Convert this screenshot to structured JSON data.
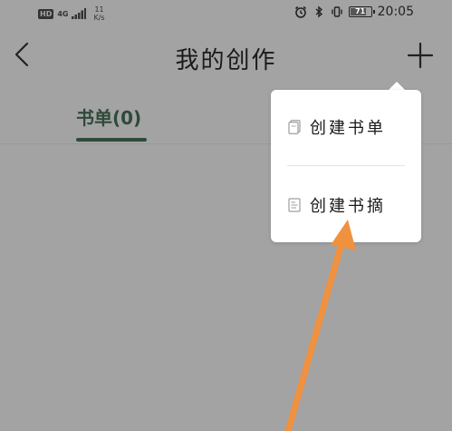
{
  "status_bar": {
    "hd": "HD",
    "network_type": "4G",
    "speed_value": "11",
    "speed_unit": "K/s",
    "battery": "71",
    "time": "20:05"
  },
  "header": {
    "title": "我的创作"
  },
  "tabs": [
    {
      "label": "书单(0)",
      "active": true
    }
  ],
  "popup_menu": {
    "items": [
      {
        "label": "创建书单",
        "icon": "booklist-doc-icon"
      },
      {
        "label": "创建书摘",
        "icon": "excerpt-doc-icon"
      }
    ]
  },
  "annotation": {
    "arrow_color": "#f0913f"
  }
}
